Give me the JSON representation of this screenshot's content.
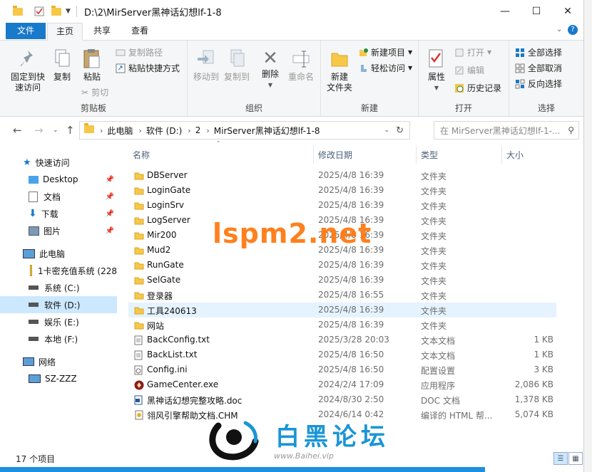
{
  "window": {
    "path_title": "D:\\2\\MirServer黑神话幻想lf-1-8",
    "controls": {
      "minimize": "—",
      "maximize": "☐",
      "close": "✕"
    }
  },
  "tabs": {
    "file": "文件",
    "home": "主页",
    "share": "共享",
    "view": "查看"
  },
  "ribbon": {
    "pin_quick": "固定到快\n速访问",
    "copy": "复制",
    "paste": "粘贴",
    "copy_path": "复制路径",
    "paste_shortcut": "粘贴快捷方式",
    "cut": "剪切",
    "group_clipboard": "剪贴板",
    "move_to": "移动到",
    "copy_to": "复制到",
    "delete": "删除",
    "rename": "重命名",
    "group_organize": "组织",
    "new_folder": "新建\n文件夹",
    "new_item": "新建项目",
    "easy_access": "轻松访问",
    "group_new": "新建",
    "properties": "属性",
    "open": "打开",
    "edit": "编辑",
    "history": "历史记录",
    "group_open": "打开",
    "select_all": "全部选择",
    "select_none": "全部取消",
    "invert_select": "反向选择",
    "group_select": "选择"
  },
  "address": {
    "crumbs": [
      "此电脑",
      "软件 (D:)",
      "2",
      "MirServer黑神话幻想lf-1-8"
    ],
    "search_placeholder": "在 MirServer黑神话幻想lf-1-..."
  },
  "nav": {
    "quick_access": "快速访问",
    "items": [
      {
        "label": "Desktop",
        "pinned": true
      },
      {
        "label": "文档",
        "pinned": true
      },
      {
        "label": "下载",
        "pinned": true
      },
      {
        "label": "图片",
        "pinned": true
      }
    ],
    "this_pc": "此电脑",
    "drives": [
      "1卡密充值系统 (228",
      "系统 (C:)",
      "软件 (D:)",
      "娱乐 (E:)",
      "本地 (F:)"
    ],
    "network": "网络",
    "network_host": "SZ-ZZZ"
  },
  "columns": {
    "name": "名称",
    "date": "修改日期",
    "type": "类型",
    "size": "大小"
  },
  "files": [
    {
      "name": "DBServer",
      "date": "2025/4/8 16:39",
      "type": "文件夹",
      "size": "",
      "icon": "folder"
    },
    {
      "name": "LoginGate",
      "date": "2025/4/8 16:39",
      "type": "文件夹",
      "size": "",
      "icon": "folder"
    },
    {
      "name": "LoginSrv",
      "date": "2025/4/8 16:39",
      "type": "文件夹",
      "size": "",
      "icon": "folder"
    },
    {
      "name": "LogServer",
      "date": "2025/4/8 16:39",
      "type": "文件夹",
      "size": "",
      "icon": "folder"
    },
    {
      "name": "Mir200",
      "date": "2025/4/8 16:39",
      "type": "文件夹",
      "size": "",
      "icon": "folder"
    },
    {
      "name": "Mud2",
      "date": "2025/4/8 16:39",
      "type": "文件夹",
      "size": "",
      "icon": "folder"
    },
    {
      "name": "RunGate",
      "date": "2025/4/8 16:39",
      "type": "文件夹",
      "size": "",
      "icon": "folder"
    },
    {
      "name": "SelGate",
      "date": "2025/4/8 16:39",
      "type": "文件夹",
      "size": "",
      "icon": "folder"
    },
    {
      "name": "登录器",
      "date": "2025/4/8 16:55",
      "type": "文件夹",
      "size": "",
      "icon": "folder"
    },
    {
      "name": "工具240613",
      "date": "2025/4/8 16:39",
      "type": "文件夹",
      "size": "",
      "icon": "folder"
    },
    {
      "name": "网站",
      "date": "2025/4/8 16:39",
      "type": "文件夹",
      "size": "",
      "icon": "folder"
    },
    {
      "name": "BackConfig.txt",
      "date": "2025/3/28 20:03",
      "type": "文本文档",
      "size": "1 KB",
      "icon": "txt"
    },
    {
      "name": "BackList.txt",
      "date": "2025/4/8 16:50",
      "type": "文本文档",
      "size": "1 KB",
      "icon": "txt"
    },
    {
      "name": "Config.ini",
      "date": "2025/4/8 16:50",
      "type": "配置设置",
      "size": "3 KB",
      "icon": "ini"
    },
    {
      "name": "GameCenter.exe",
      "date": "2024/2/4 17:09",
      "type": "应用程序",
      "size": "2,086 KB",
      "icon": "exe"
    },
    {
      "name": "黑神话幻想完整攻略.doc",
      "date": "2024/8/30 2:50",
      "type": "DOC 文档",
      "size": "1,378 KB",
      "icon": "doc"
    },
    {
      "name": "翎风引擎帮助文档.CHM",
      "date": "2024/6/14 0:42",
      "type": "编译的 HTML 帮...",
      "size": "5,074 KB",
      "icon": "chm"
    }
  ],
  "status": {
    "count": "17 个项目"
  },
  "watermark": {
    "site1": "lspm2.net",
    "site2_title": "白黑论坛",
    "site2_url": "www.Baihei.vip"
  },
  "colors": {
    "accent": "#1979ca",
    "folder": "#f7c748",
    "selected": "#cce8ff",
    "hover": "#e5f3ff",
    "watermark1": "#ff7a12",
    "watermark2": "#1a95d6"
  }
}
